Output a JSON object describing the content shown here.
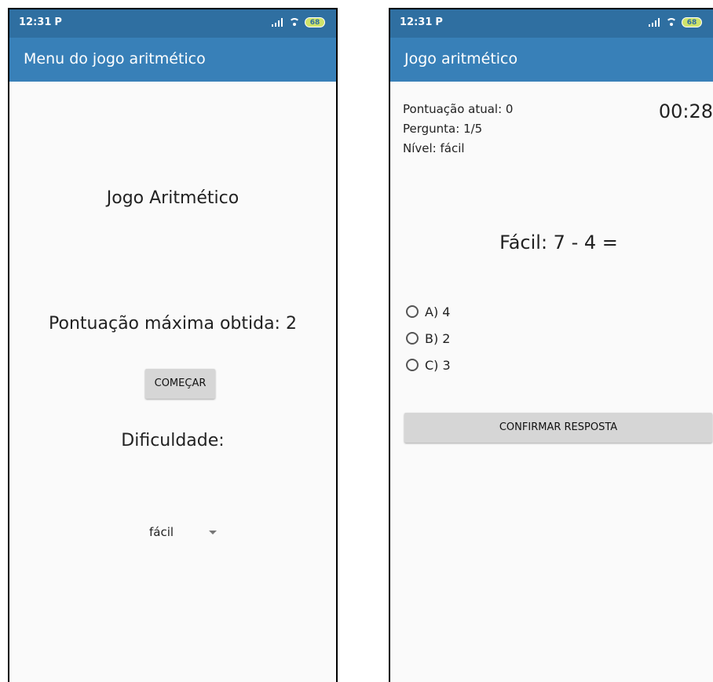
{
  "left_screen": {
    "status_time": "12:31",
    "status_p": "P",
    "battery": "68",
    "app_title": "Menu do jogo aritmético",
    "game_title": "Jogo Aritmético",
    "high_score": "Pontuação máxima obtida: 2",
    "start_button": "COMEÇAR",
    "difficulty_label": "Dificuldade:",
    "difficulty_selected": "fácil"
  },
  "right_screen": {
    "status_time": "12:31",
    "status_p": "P",
    "battery": "68",
    "app_title": "Jogo aritmético",
    "current_score": "Pontuação atual: 0",
    "question_counter": "Pergunta: 1/5",
    "level": "Nível: fácil",
    "timer": "00:28",
    "question": "Fácil: 7 - 4 =",
    "options": [
      "A) 4",
      "B) 2",
      "C) 3"
    ],
    "confirm_button": "CONFIRMAR RESPOSTA"
  },
  "colors": {
    "status_bar": "#2f6fa1",
    "app_bar": "#3880b8",
    "background": "#fafafa",
    "button": "#d6d6d6"
  }
}
